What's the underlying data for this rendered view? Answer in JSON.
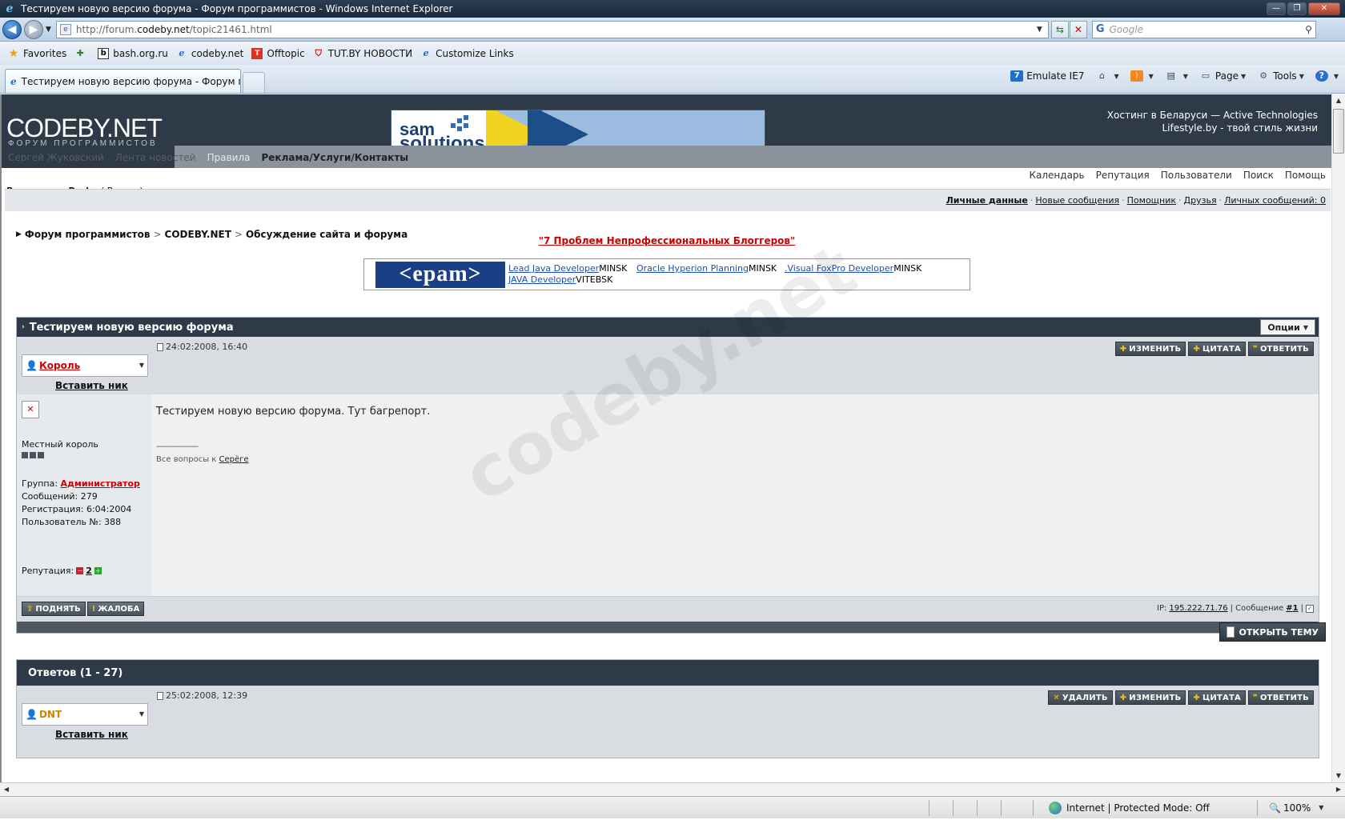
{
  "window": {
    "title": "Тестируем новую версию форума - Форум программистов - Windows Internet Explorer"
  },
  "addressbar": {
    "url_prefix": "http://forum.",
    "url_domain": "codeby.net",
    "url_path": "/topic21461.html",
    "search_placeholder": "Google"
  },
  "favorites": {
    "label": "Favorites",
    "links": [
      "bash.org.ru",
      "codeby.net",
      "Offtopic",
      "TUT.BY  НОВОСТИ",
      "Customize Links"
    ]
  },
  "tab": {
    "label": "Тестируем новую версию форума - Форум пр..."
  },
  "commandbar": {
    "emulate": "Emulate IE7",
    "page": "Page",
    "tools": "Tools"
  },
  "site": {
    "logo": "CODEBY.NET",
    "logo_sub": "ФОРУМ ПРОГРАММИСТОВ",
    "banner_line1": "sam",
    "banner_line2": "solutions",
    "header_right_1": "Хостинг в Беларуси — Active Technologies",
    "header_right_2": "Lifestyle.by - твой стиль жизни",
    "nav": [
      "Сергей Жуковский",
      "Лента новостей",
      "Правила",
      "Реклама/Услуги/Контакты"
    ],
    "topnav": [
      "Календарь",
      "Репутация",
      "Пользователи",
      "Поиск",
      "Помощь"
    ],
    "logged_in_label": "Вошли как:",
    "username": "Pasha",
    "logout": "Выход",
    "user_links": [
      "Личные данные",
      "Новые сообщения",
      "Помощник",
      "Друзья",
      "Личных сообщений: 0"
    ],
    "breadcrumb": [
      "Форум программистов",
      "CODEBY.NET",
      "Обсуждение сайта и форума"
    ],
    "promo": "\"7 Проблем Непрофессиональных Блоггеров\"",
    "jobs_logo": "<epam>",
    "jobs": [
      {
        "title": "Lead Java Developer",
        "city": "MINSK"
      },
      {
        "title": "Oracle Hyperion Planning",
        "city": "MINSK"
      },
      {
        "title": ".Visual FoxPro Developer",
        "city": "MINSK"
      },
      {
        "title": "JAVA Developer",
        "city": "VITEBSK"
      }
    ],
    "watermark": "codeby.net"
  },
  "topic": {
    "title": "Тестируем новую версию форума",
    "options": "Опции",
    "post": {
      "date": "24:02:2008, 16:40",
      "author": "Король",
      "insert_nick": "Вставить ник",
      "rank": "Местный король",
      "group_label": "Группа:",
      "group": "Администратор",
      "messages": "Сообщений: 279",
      "registered": "Регистрация: 6:04:2004",
      "user_no": "Пользователь №: 388",
      "rep_label": "Репутация:",
      "rep_value": "2",
      "text": "Тестируем новую версию форума. Тут багрепорт.",
      "sig_dashes": "--------------------",
      "sig_prefix": "Все вопросы к",
      "sig_link": "Серёге",
      "buttons": [
        "ИЗМЕНИТЬ",
        "ЦИТАТА",
        "ОТВЕТИТЬ"
      ],
      "foot_buttons": [
        "ПОДНЯТЬ",
        "ЖАЛОБА"
      ],
      "ip_label": "IP:",
      "ip": "195.222.71.76",
      "msg_label": "| Сообщение",
      "msg_no": "#1"
    }
  },
  "open_topic": "ОТКРЫТЬ ТЕМУ",
  "replies": {
    "title": "Ответов (1 - 27)",
    "post": {
      "date": "25:02:2008, 12:39",
      "author": "DNT",
      "insert_nick": "Вставить ник",
      "buttons": [
        "УДАЛИТЬ",
        "ИЗМЕНИТЬ",
        "ЦИТАТА",
        "ОТВЕТИТЬ"
      ]
    }
  },
  "statusbar": {
    "zone": "Internet | Protected Mode: Off",
    "zoom": "100%"
  }
}
